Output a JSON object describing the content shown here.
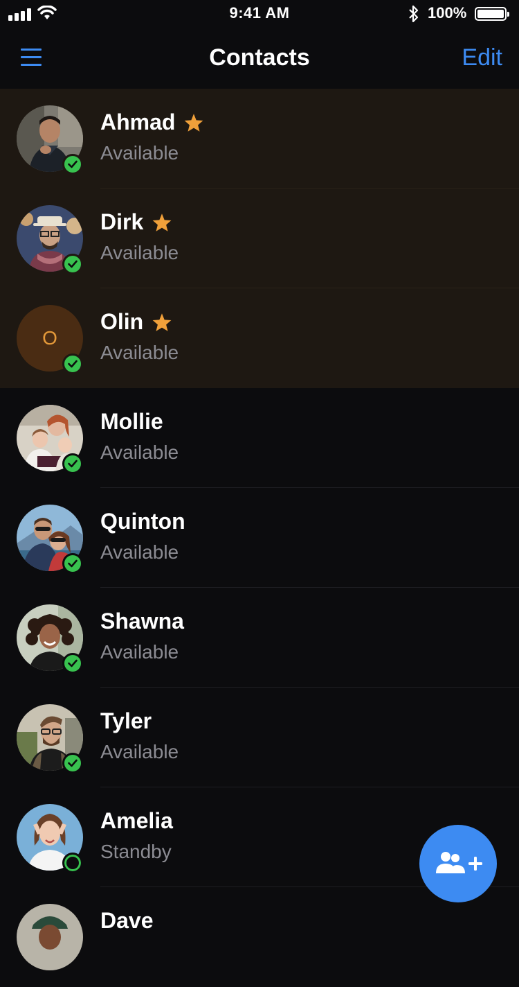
{
  "status_bar": {
    "time": "9:41 AM",
    "battery": "100%"
  },
  "nav": {
    "title": "Contacts",
    "edit_label": "Edit",
    "menu_icon": "hamburger-menu-icon"
  },
  "contacts": [
    {
      "name": "Ahmad",
      "status": "Available",
      "favorite": true,
      "presence": "available"
    },
    {
      "name": "Dirk",
      "status": "Available",
      "favorite": true,
      "presence": "available"
    },
    {
      "name": "Olin",
      "status": "Available",
      "favorite": true,
      "presence": "available",
      "initial": "O"
    },
    {
      "name": "Mollie",
      "status": "Available",
      "favorite": false,
      "presence": "available"
    },
    {
      "name": "Quinton",
      "status": "Available",
      "favorite": false,
      "presence": "available"
    },
    {
      "name": "Shawna",
      "status": "Available",
      "favorite": false,
      "presence": "available"
    },
    {
      "name": "Tyler",
      "status": "Available",
      "favorite": false,
      "presence": "available"
    },
    {
      "name": "Amelia",
      "status": "Standby",
      "favorite": false,
      "presence": "standby"
    },
    {
      "name": "Dave",
      "status": "",
      "favorite": false,
      "presence": "available"
    }
  ],
  "fab": {
    "icon": "add-contact-icon"
  },
  "colors": {
    "accent": "#3d8bf2",
    "star": "#f0a03a",
    "presence": "#38c24f",
    "favorite_bg": "#1e1812",
    "background": "#0c0c0e"
  }
}
